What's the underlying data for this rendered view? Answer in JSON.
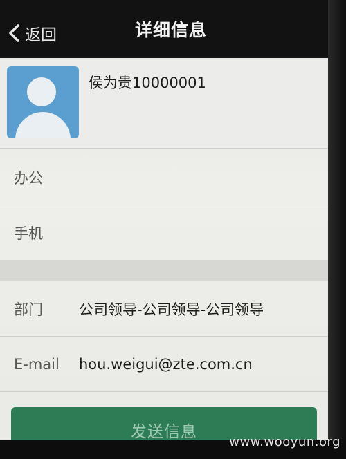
{
  "header": {
    "back_label": "返回",
    "title": "详细信息"
  },
  "profile": {
    "name": "侯为贵10000001"
  },
  "fields": [
    {
      "label": "办公",
      "value": ""
    },
    {
      "label": "手机",
      "value": ""
    },
    {
      "label": "部门",
      "value": "公司领导-公司领导-公司领导"
    },
    {
      "label": "E-mail",
      "value": "hou.weigui@zte.com.cn"
    }
  ],
  "actions": {
    "send_label": "发送信息"
  },
  "watermark": "www.wooyun.org"
}
